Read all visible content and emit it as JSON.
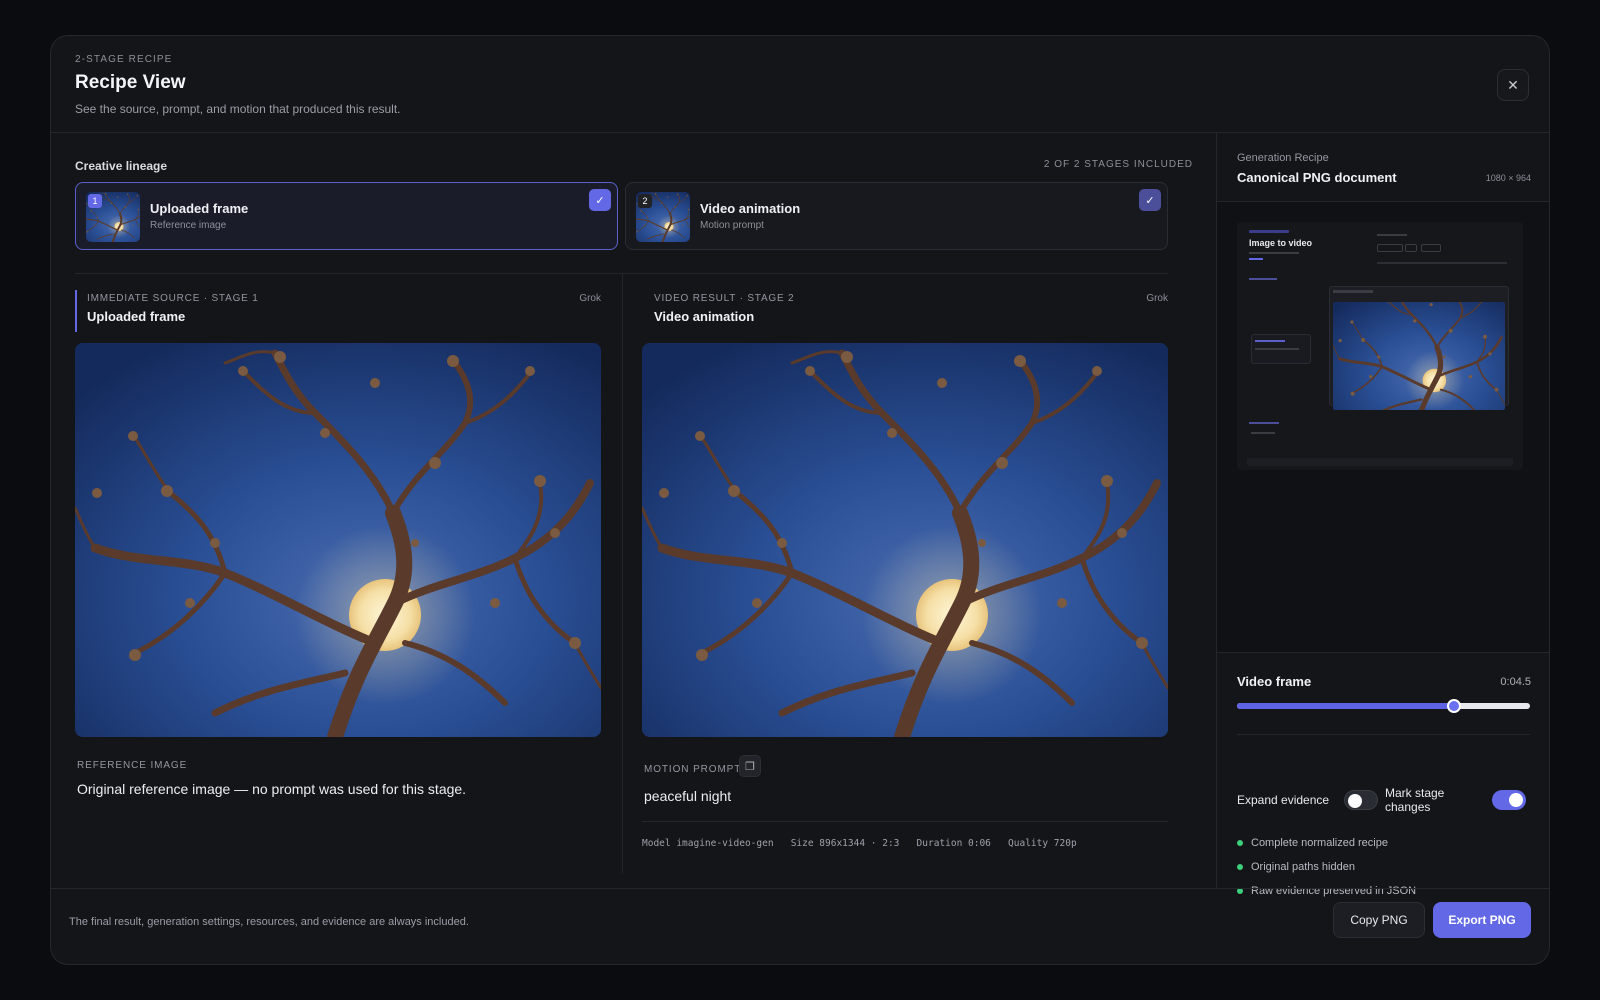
{
  "header": {
    "eyebrow": "2-STAGE RECIPE",
    "title": "Recipe View",
    "subtitle": "See the source, prompt, and motion that produced this result.",
    "close_icon": "close-icon"
  },
  "lineage": {
    "label": "Creative lineage",
    "count": "2 OF 2 STAGES INCLUDED",
    "stages": [
      {
        "number": "1",
        "title": "Uploaded frame",
        "subtitle": "Reference image",
        "selected": true
      },
      {
        "number": "2",
        "title": "Video animation",
        "subtitle": "Motion prompt",
        "selected": true
      }
    ]
  },
  "source": {
    "eyebrow": "IMMEDIATE SOURCE · STAGE 1",
    "title": "Uploaded frame",
    "provider": "Grok",
    "meta_label": "REFERENCE IMAGE",
    "text": "Original reference image — no prompt was used for this stage."
  },
  "result": {
    "eyebrow": "VIDEO RESULT · STAGE 2",
    "title": "Video animation",
    "provider": "Grok",
    "meta_label": "MOTION PROMPT",
    "text": "peaceful night",
    "specs": "Model imagine-video-gen   Size 896x1344 · 2:3   Duration 0:06   Quality 720p"
  },
  "recipe": {
    "eyebrow": "Generation Recipe",
    "title": "Canonical PNG document",
    "dimensions": "1080 × 964",
    "preview_title": "Image to video"
  },
  "video_frame": {
    "label": "Video frame",
    "time": "0:04.5",
    "progress": 0.74
  },
  "toggles": {
    "expand_evidence": {
      "label": "Expand evidence",
      "on": false
    },
    "mark_stage_changes": {
      "label": "Mark stage changes",
      "on": true
    }
  },
  "evidence": [
    "Complete normalized recipe",
    "Original paths hidden",
    "Raw evidence preserved in JSON"
  ],
  "footer": {
    "note": "The final result, generation settings, resources, and evidence are always included.",
    "copy_label": "Copy PNG",
    "export_label": "Export PNG"
  },
  "colors": {
    "accent": "#6268e6",
    "success": "#3ecf7a",
    "background": "#141519"
  }
}
